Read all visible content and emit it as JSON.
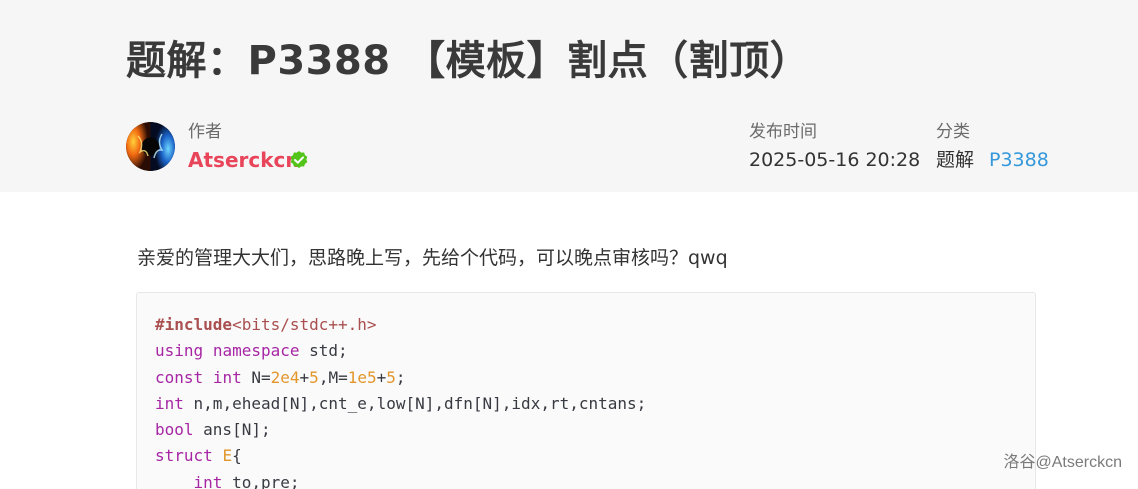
{
  "article": {
    "title": "题解：P3388 【模板】割点（割顶）",
    "author_label": "作者",
    "author_name": "Atserckcn",
    "published_label": "发布时间",
    "published_value": "2025-05-16 20:28",
    "category_label": "分类",
    "category_value": "题解",
    "category_tag": "P3388",
    "intro": "亲爱的管理大大们，思路晚上写，先给个代码，可以晚点审核吗？qwq"
  },
  "code": {
    "lines": [
      {
        "parts": [
          {
            "t": "#include",
            "c": "inc"
          },
          {
            "t": "<bits/stdc++.h>",
            "c": "str"
          }
        ]
      },
      {
        "parts": [
          {
            "t": "using",
            "c": "kw"
          },
          {
            "t": " "
          },
          {
            "t": "namespace",
            "c": "kw"
          },
          {
            "t": " std;"
          }
        ]
      },
      {
        "parts": [
          {
            "t": "const",
            "c": "kw"
          },
          {
            "t": " "
          },
          {
            "t": "int",
            "c": "kw"
          },
          {
            "t": " N="
          },
          {
            "t": "2e4",
            "c": "num"
          },
          {
            "t": "+"
          },
          {
            "t": "5",
            "c": "num"
          },
          {
            "t": ",M="
          },
          {
            "t": "1e5",
            "c": "num"
          },
          {
            "t": "+"
          },
          {
            "t": "5",
            "c": "num"
          },
          {
            "t": ";"
          }
        ]
      },
      {
        "parts": [
          {
            "t": "int",
            "c": "kw"
          },
          {
            "t": " n,m,ehead[N],cnt_e,low[N],dfn[N],idx,rt,cntans;"
          }
        ]
      },
      {
        "parts": [
          {
            "t": "bool",
            "c": "kw"
          },
          {
            "t": " ans[N];"
          }
        ]
      },
      {
        "parts": [
          {
            "t": "struct",
            "c": "kw"
          },
          {
            "t": " "
          },
          {
            "t": "E",
            "c": "cls"
          },
          {
            "t": "{"
          }
        ]
      },
      {
        "parts": [
          {
            "t": "    "
          },
          {
            "t": "int",
            "c": "kw"
          },
          {
            "t": " to,pre;"
          }
        ]
      }
    ]
  },
  "watermark": "洛谷@Atserckcn",
  "colors": {
    "author": "#e9455a",
    "link": "#3498db",
    "verified": "#52c41a",
    "keyword": "#a626a4",
    "number": "#e2962b"
  },
  "icons": {
    "avatar": "fire-ice-avatar",
    "verified": "verified-check-icon"
  }
}
